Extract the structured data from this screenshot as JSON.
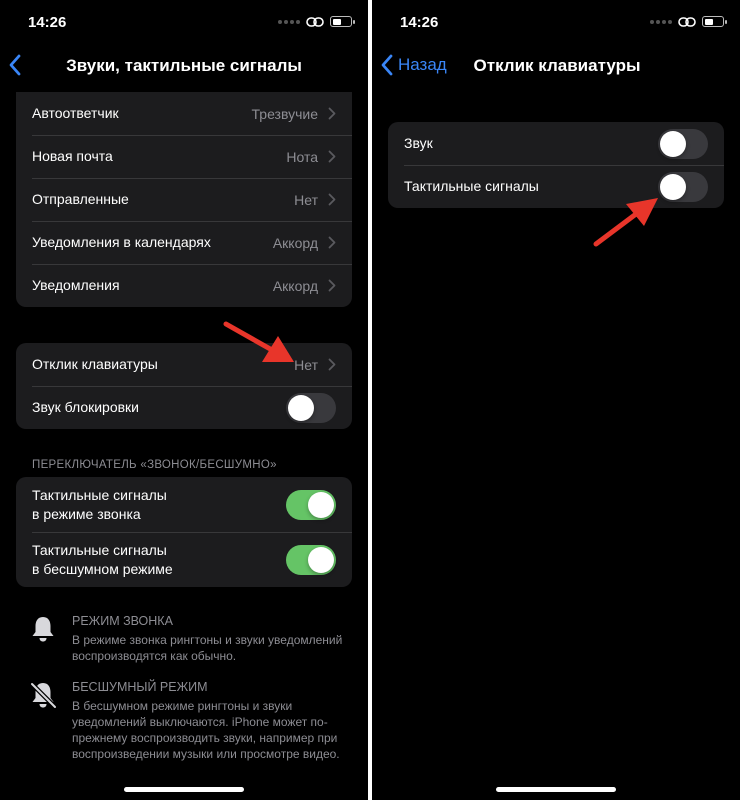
{
  "left": {
    "status": {
      "time": "14:26"
    },
    "nav": {
      "title": "Звуки, тактильные сигналы"
    },
    "sounds_group": [
      {
        "label": "Автоответчик",
        "value": "Трезвучие"
      },
      {
        "label": "Новая почта",
        "value": "Нота"
      },
      {
        "label": "Отправленные",
        "value": "Нет"
      },
      {
        "label": "Уведомления в календарях",
        "value": "Аккорд"
      },
      {
        "label": "Уведомления",
        "value": "Аккорд"
      }
    ],
    "keyboard_group": {
      "feedback_label": "Отклик клавиатуры",
      "feedback_value": "Нет",
      "lock_sound_label": "Звук блокировки",
      "lock_sound_on": false
    },
    "switch_section": {
      "header": "ПЕРЕКЛЮЧАТЕЛЬ «ЗВОНОК/БЕСШУМНО»",
      "ring_haptics_line1": "Тактильные сигналы",
      "ring_haptics_line2": "в режиме звонка",
      "ring_haptics_on": true,
      "silent_haptics_line1": "Тактильные сигналы",
      "silent_haptics_line2": "в бесшумном режиме",
      "silent_haptics_on": true
    },
    "info": {
      "ring_title": "РЕЖИМ ЗВОНКА",
      "ring_text": "В режиме звонка рингтоны и звуки уведомлений воспроизводятся как обычно.",
      "silent_title": "БЕСШУМНЫЙ РЕЖИМ",
      "silent_text": "В бесшумном режиме рингтоны и звуки уведомлений выключаются. iPhone может по-прежнему воспроизводить звуки, например при воспроизведении музыки или просмотре видео."
    }
  },
  "right": {
    "status": {
      "time": "14:26"
    },
    "nav": {
      "back_label": "Назад",
      "title": "Отклик клавиатуры"
    },
    "rows": [
      {
        "label": "Звук",
        "on": false
      },
      {
        "label": "Тактильные сигналы",
        "on": false
      }
    ]
  },
  "colors": {
    "background": "#000000",
    "group_bg": "#1c1c1e",
    "accent_blue": "#3a86f7",
    "toggle_on": "#65c466",
    "toggle_off": "#39393d",
    "arrow_red": "#e8352a",
    "secondary_text": "#8d8d93"
  },
  "icons": [
    "chevron-left-icon",
    "chevron-right-icon",
    "bell-icon",
    "bell-slash-icon",
    "link-icon",
    "battery-icon",
    "arrow-annotation"
  ]
}
